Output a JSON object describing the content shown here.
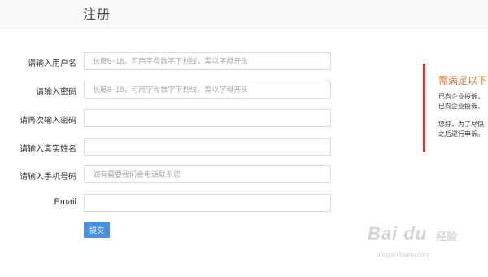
{
  "header": {
    "title": "注册"
  },
  "form": {
    "fields": [
      {
        "label": "请输入用户名",
        "value": "",
        "placeholder": "长度6~18，可用字母数字下划线，需以字母开头"
      },
      {
        "label": "请输入密码",
        "value": "",
        "placeholder": "长度8~18，可用字母数字下划线，需以字母开头"
      },
      {
        "label": "请再次输入密码",
        "value": "",
        "placeholder": ""
      },
      {
        "label": "请输入真实姓名",
        "value": "",
        "placeholder": ""
      },
      {
        "label": "请输入手机号码",
        "value": "",
        "placeholder": "如有需要我们会电话联系您"
      },
      {
        "label": "Email",
        "value": "",
        "placeholder": ""
      }
    ],
    "submit_label": "提交"
  },
  "side_panel": {
    "title": "需满足以下",
    "lines": [
      "已向企业投诉，",
      "已向企业投诉，",
      "您好，为了尽快",
      "之后进行申诉。"
    ],
    "accent_color": "#c83a3a",
    "title_color": "#e07a2e"
  },
  "watermark": {
    "logo": "Bai du",
    "brand": "经验",
    "url": "jingyan.baidu.com"
  },
  "colors": {
    "submit_bg": "#4a90e2",
    "header_bg": "#f9f9f9"
  }
}
